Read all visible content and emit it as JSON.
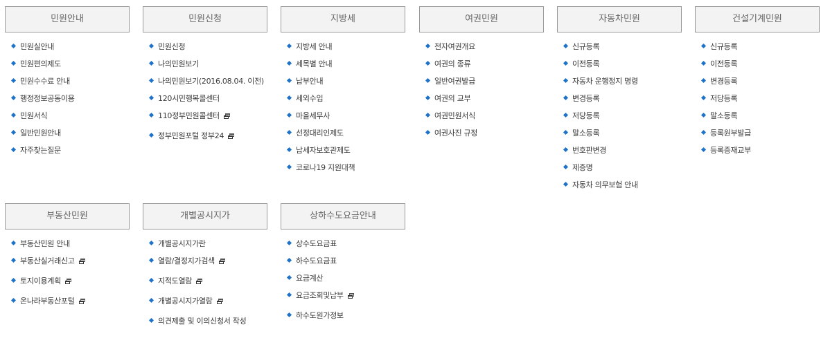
{
  "sections": [
    {
      "title": "민원안내",
      "items": [
        {
          "label": "민원실안내",
          "external": false
        },
        {
          "label": "민원편의제도",
          "external": false
        },
        {
          "label": "민원수수료 안내",
          "external": false
        },
        {
          "label": "행정정보공동이용",
          "external": false
        },
        {
          "label": "민원서식",
          "external": false
        },
        {
          "label": "일반민원안내",
          "external": false
        },
        {
          "label": "자주찾는질문",
          "external": false
        }
      ]
    },
    {
      "title": "민원신청",
      "items": [
        {
          "label": "민원신청",
          "external": false
        },
        {
          "label": "나의민원보기",
          "external": false
        },
        {
          "label": "나의민원보기(2016.08.04. 이전)",
          "external": false
        },
        {
          "label": "120시민행복콜센터",
          "external": false
        },
        {
          "label": "110정부민원콜센터",
          "external": true
        },
        {
          "label": "정부민원포털 정부24",
          "external": true
        }
      ]
    },
    {
      "title": "지방세",
      "items": [
        {
          "label": "지방세 안내",
          "external": false
        },
        {
          "label": "세목별 안내",
          "external": false
        },
        {
          "label": "납부안내",
          "external": false
        },
        {
          "label": "세외수입",
          "external": false
        },
        {
          "label": "마을세무사",
          "external": false
        },
        {
          "label": "선정대리인제도",
          "external": false
        },
        {
          "label": "납세자보호관제도",
          "external": false
        },
        {
          "label": "코로나19 지원대책",
          "external": false
        }
      ]
    },
    {
      "title": "여권민원",
      "items": [
        {
          "label": "전자여권개요",
          "external": false
        },
        {
          "label": "여권의 종류",
          "external": false
        },
        {
          "label": "일반여권발급",
          "external": false
        },
        {
          "label": "여권의 교부",
          "external": false
        },
        {
          "label": "여권민원서식",
          "external": false
        },
        {
          "label": "여권사진 규정",
          "external": false
        }
      ]
    },
    {
      "title": "자동차민원",
      "items": [
        {
          "label": "신규등록",
          "external": false
        },
        {
          "label": "이전등록",
          "external": false
        },
        {
          "label": "자동차 운행정지 명령",
          "external": false
        },
        {
          "label": "변경등록",
          "external": false
        },
        {
          "label": "저당등록",
          "external": false
        },
        {
          "label": "말소등록",
          "external": false
        },
        {
          "label": "번호판변경",
          "external": false
        },
        {
          "label": "제증명",
          "external": false
        },
        {
          "label": "자동차 의무보험 안내",
          "external": false
        }
      ]
    },
    {
      "title": "건설기계민원",
      "items": [
        {
          "label": "신규등록",
          "external": false
        },
        {
          "label": "이전등록",
          "external": false
        },
        {
          "label": "변경등록",
          "external": false
        },
        {
          "label": "저당등록",
          "external": false
        },
        {
          "label": "말소등록",
          "external": false
        },
        {
          "label": "등록원부발급",
          "external": false
        },
        {
          "label": "등록증재교부",
          "external": false
        }
      ]
    },
    {
      "title": "부동산민원",
      "items": [
        {
          "label": "부동산민원 안내",
          "external": false
        },
        {
          "label": "부동산실거래신고",
          "external": true
        },
        {
          "label": "토지이용계획",
          "external": true
        },
        {
          "label": "온나라부동산포털",
          "external": true
        }
      ]
    },
    {
      "title": "개별공시지가",
      "items": [
        {
          "label": "개별공시지가란",
          "external": false
        },
        {
          "label": "열람/결정지가검색",
          "external": true
        },
        {
          "label": "지적도열람",
          "external": true
        },
        {
          "label": "개별공시지가열람",
          "external": true
        },
        {
          "label": "의견제출 및 이의신청서 작성",
          "external": false
        }
      ]
    },
    {
      "title": "상하수도요금안내",
      "items": [
        {
          "label": "상수도요금표",
          "external": false
        },
        {
          "label": "하수도요금표",
          "external": false
        },
        {
          "label": "요금계산",
          "external": false
        },
        {
          "label": "요금조회및납부",
          "external": true
        },
        {
          "label": "하수도원가정보",
          "external": false
        }
      ]
    }
  ],
  "icons": {
    "bullet": "diamond-bullet-icon",
    "external": "new-window-icon"
  },
  "colors": {
    "bullet": "#1f72c9",
    "header_bg": "#f3f3f3",
    "header_border": "#999999"
  }
}
